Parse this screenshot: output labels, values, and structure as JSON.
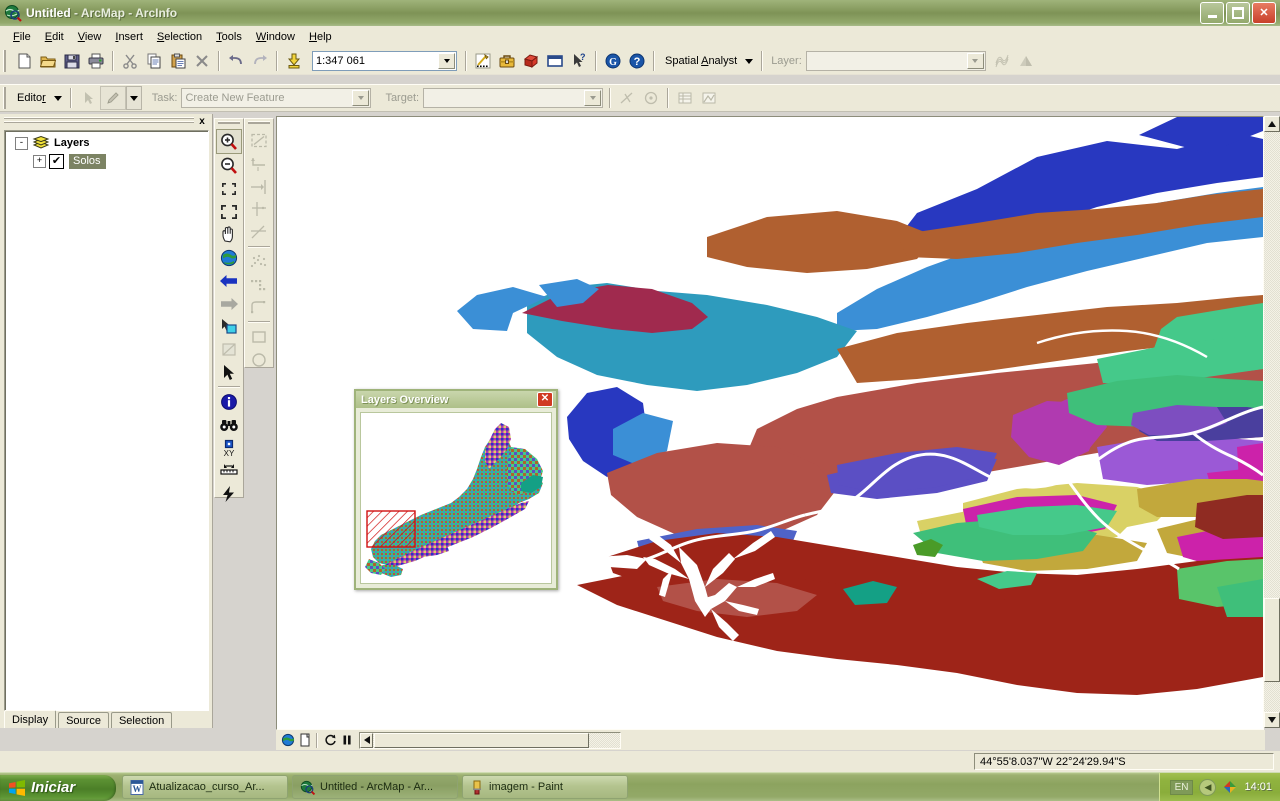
{
  "window": {
    "title_main": "Untitled",
    "title_rest": " - ArcMap - ArcInfo",
    "app_icon": "arcmap-globe-icon",
    "minimize_label": "Minimize",
    "restore_label": "Restore",
    "close_label": "Close"
  },
  "menu": {
    "items": [
      {
        "label": "File",
        "accel": "F"
      },
      {
        "label": "Edit",
        "accel": "E"
      },
      {
        "label": "View",
        "accel": "V"
      },
      {
        "label": "Insert",
        "accel": "I"
      },
      {
        "label": "Selection",
        "accel": "S"
      },
      {
        "label": "Tools",
        "accel": "T"
      },
      {
        "label": "Window",
        "accel": "W"
      },
      {
        "label": "Help",
        "accel": "H"
      }
    ]
  },
  "standard_toolbar": {
    "buttons": [
      {
        "name": "new-document-icon",
        "title": "New"
      },
      {
        "name": "open-folder-icon",
        "title": "Open"
      },
      {
        "name": "save-disk-icon",
        "title": "Save"
      },
      {
        "name": "print-icon",
        "title": "Print"
      },
      {
        "name": "cut-scissors-icon",
        "title": "Cut"
      },
      {
        "name": "copy-icon",
        "title": "Copy"
      },
      {
        "name": "paste-clipboard-icon",
        "title": "Paste"
      },
      {
        "name": "delete-x-icon",
        "title": "Delete"
      },
      {
        "name": "undo-arrow-icon",
        "title": "Undo"
      },
      {
        "name": "redo-arrow-icon",
        "title": "Redo"
      },
      {
        "name": "add-data-plus-icon",
        "title": "Add Data"
      }
    ],
    "scale_value": "1:347 061",
    "scale_placeholder": "1:347 061",
    "after_scale": [
      {
        "name": "editor-sketch-icon",
        "title": "Editor Toolbar"
      },
      {
        "name": "toolbox-icon",
        "title": "ArcToolbox"
      },
      {
        "name": "model-builder-icon",
        "title": "ModelBuilder"
      },
      {
        "name": "command-line-icon",
        "title": "Show Command Line Window"
      },
      {
        "name": "whats-this-help-icon",
        "title": "What's This?"
      },
      {
        "name": "geography-network-icon",
        "title": "Geography Network"
      },
      {
        "name": "help-question-icon",
        "title": "ArcGIS Desktop Help"
      }
    ],
    "spatial_analyst_label": "Spatial Analyst",
    "layer_label": "Layer:",
    "layer_value": "",
    "extra_buttons": [
      {
        "name": "raster-texture-icon",
        "title": "Histogram"
      },
      {
        "name": "raster-hillshade-icon",
        "title": "Layer Properties"
      }
    ]
  },
  "editor_toolbar": {
    "editor_label": "Editor",
    "buttons": [
      {
        "name": "edit-arrow-icon",
        "title": "Edit Tool"
      },
      {
        "name": "sketch-pencil-icon",
        "title": "Sketch Tool"
      }
    ],
    "task_label": "Task:",
    "task_value": "Create New Feature",
    "target_label": "Target:",
    "target_value": "",
    "right_buttons": [
      {
        "name": "split-tool-icon",
        "title": "Split Tool"
      },
      {
        "name": "rotate-tool-icon",
        "title": "Rotate Tool"
      },
      {
        "name": "attributes-table-icon",
        "title": "Attributes"
      },
      {
        "name": "sketch-properties-icon",
        "title": "Sketch Properties"
      }
    ]
  },
  "toc": {
    "close_label": "x",
    "root": {
      "label": "Layers",
      "icon": "layers-stack-icon",
      "expander": "-"
    },
    "layers": [
      {
        "label": "Solos",
        "checked": true,
        "expander": "+",
        "selected": true
      }
    ],
    "tabs": [
      {
        "label": "Display",
        "active": true
      },
      {
        "label": "Source",
        "active": false
      },
      {
        "label": "Selection",
        "active": false
      }
    ]
  },
  "tools_toolbar": {
    "column1": [
      {
        "name": "zoom-in-icon",
        "title": "Zoom In",
        "selected": true
      },
      {
        "name": "zoom-out-icon",
        "title": "Zoom Out"
      },
      {
        "name": "fixed-zoom-in-icon",
        "title": "Fixed Zoom In"
      },
      {
        "name": "fixed-zoom-out-icon",
        "title": "Fixed Zoom Out"
      },
      {
        "name": "pan-hand-icon",
        "title": "Pan"
      },
      {
        "name": "full-extent-globe-icon",
        "title": "Full Extent"
      },
      {
        "name": "back-extent-arrow-icon",
        "title": "Go Back To Previous Extent"
      },
      {
        "name": "forward-extent-arrow-icon",
        "title": "Go To Next Extent"
      },
      {
        "name": "select-features-icon",
        "title": "Select Features"
      },
      {
        "name": "clear-selection-icon",
        "title": "Clear Selected Features"
      },
      {
        "name": "select-elements-arrow-icon",
        "title": "Select Elements"
      },
      {
        "name": "identify-info-icon",
        "title": "Identify"
      },
      {
        "name": "find-binoculars-icon",
        "title": "Find"
      },
      {
        "name": "go-to-xy-icon",
        "title": "Go To XY"
      },
      {
        "name": "measure-ruler-icon",
        "title": "Measure"
      },
      {
        "name": "hyperlink-lightning-icon",
        "title": "Hyperlink"
      }
    ],
    "column2": [
      {
        "name": "sketch-rectangle-icon",
        "title": "Sketch Rectangle"
      },
      {
        "name": "sketch-segment-icon",
        "title": "Sketch Segment"
      },
      {
        "name": "sketch-endpoint-icon",
        "title": "Distance-Distance Tool"
      },
      {
        "name": "sketch-intersection-icon",
        "title": "Intersection Tool"
      },
      {
        "name": "sketch-midpoint-icon",
        "title": "Midpoint Tool"
      },
      {
        "name": "sketch-scatter-icon",
        "title": "Trace Tool"
      },
      {
        "name": "sketch-corner-icon",
        "title": "Tangent Curve Tool"
      },
      {
        "name": "sketch-arc-icon",
        "title": "Arc Tool"
      },
      {
        "name": "sketch-square-icon",
        "title": "Rectangle"
      },
      {
        "name": "sketch-circle-icon",
        "title": "Circle"
      }
    ]
  },
  "overview_window": {
    "title": "Layers Overview",
    "close_label": "x",
    "extent_indicator": "red-hatched-extent-rectangle"
  },
  "map_bottom_bar": {
    "buttons": [
      {
        "name": "data-view-globe-icon",
        "title": "Data View"
      },
      {
        "name": "layout-view-page-icon",
        "title": "Layout View"
      },
      {
        "name": "refresh-view-icon",
        "title": "Refresh View"
      },
      {
        "name": "pause-drawing-icon",
        "title": "Pause Drawing"
      }
    ],
    "scroll_left_label": "◄"
  },
  "status_bar": {
    "message": "",
    "coordinates": "44°55'8.037\"W  22°24'29.94\"S"
  },
  "taskbar": {
    "start_label": "Iniciar",
    "start_icon": "windows-flag-icon",
    "tasks": [
      {
        "label": "Atualizacao_curso_Ar...",
        "icon": "word-document-icon",
        "active": false
      },
      {
        "label": "Untitled - ArcMap - Ar...",
        "icon": "arcmap-globe-icon",
        "active": true
      },
      {
        "label": "imagem - Paint",
        "icon": "paint-brush-icon",
        "active": false
      }
    ],
    "tray": {
      "language": "EN",
      "chevron": "◀",
      "icon": "security-shield-icon",
      "time": "14:01"
    }
  },
  "map": {
    "layer_name": "Solos",
    "background": "#ffffff",
    "river_color": "#ffffff",
    "palette": [
      "#2838c0",
      "#3b8fd6",
      "#2e9bbd",
      "#b06030",
      "#b25148",
      "#a02a4e",
      "#9b3070",
      "#b03ab0",
      "#cc22aa",
      "#9b59d6",
      "#5b4fc4",
      "#4f63c8",
      "#45c98a",
      "#3fbf7a",
      "#59c46a",
      "#d9d165",
      "#c2a83c",
      "#b8992f",
      "#9e2418",
      "#8f2b22",
      "#4a3f9e",
      "#7d4ec0",
      "#3aa0e0",
      "#267abf",
      "#14a085"
    ]
  }
}
